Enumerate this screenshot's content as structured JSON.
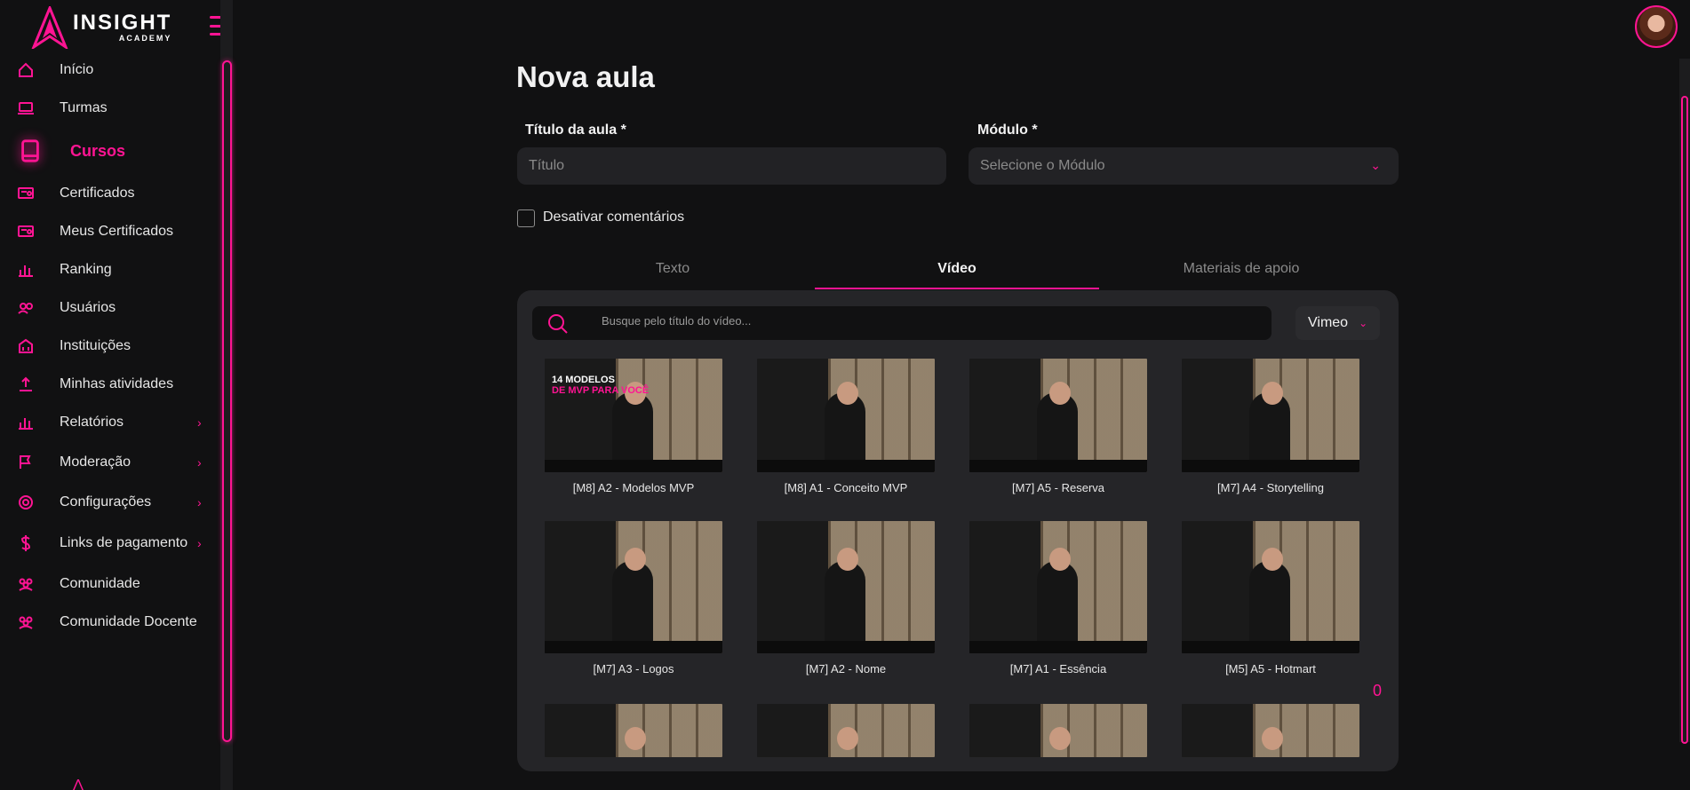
{
  "brand": {
    "name": "INSIGHT",
    "sub": "ACADEMY",
    "accent": "#ff1493"
  },
  "sidebar": {
    "items": [
      {
        "label": "Início",
        "icon": "home-icon"
      },
      {
        "label": "Turmas",
        "icon": "laptop-icon"
      },
      {
        "label": "Cursos",
        "icon": "book-icon",
        "active": true
      },
      {
        "label": "Certificados",
        "icon": "certificate-icon"
      },
      {
        "label": "Meus Certificados",
        "icon": "certificate-icon"
      },
      {
        "label": "Ranking",
        "icon": "bar-chart-icon"
      },
      {
        "label": "Usuários",
        "icon": "users-icon"
      },
      {
        "label": "Instituições",
        "icon": "building-icon"
      },
      {
        "label": "Minhas atividades",
        "icon": "upload-icon"
      },
      {
        "label": "Relatórios",
        "icon": "bar-chart-icon",
        "chevron": "›"
      },
      {
        "label": "Moderação",
        "icon": "flag-icon",
        "chevron": "›"
      },
      {
        "label": "Configurações",
        "icon": "gear-icon",
        "chevron": "›"
      },
      {
        "label": "Links de pagamento",
        "icon": "dollar-icon",
        "chevron": "›"
      },
      {
        "label": "Comunidade",
        "icon": "community-icon"
      },
      {
        "label": "Comunidade Docente",
        "icon": "community-icon"
      }
    ]
  },
  "form": {
    "title": "Nova aula",
    "lesson_title_label": "Título da aula *",
    "lesson_title_placeholder": "Título",
    "module_label": "Módulo *",
    "module_placeholder": "Selecione o Módulo",
    "disable_comments_label": "Desativar comentários"
  },
  "tabs": [
    {
      "label": "Texto"
    },
    {
      "label": "Vídeo",
      "active": true
    },
    {
      "label": "Materiais de apoio"
    }
  ],
  "video_panel": {
    "search_placeholder": "Busque pelo título do vídeo...",
    "provider": "Vimeo",
    "counter": "0",
    "videos": [
      {
        "title": "[M8] A2 - Modelos MVP",
        "overlay": "14 MODELOS",
        "overlay2": "DE MVP PARA VOCÊ"
      },
      {
        "title": "[M8] A1 - Conceito MVP",
        "overlay": "",
        "overlay2": ""
      },
      {
        "title": "[M7] A5 - Reserva",
        "overlay": "",
        "overlay2": ""
      },
      {
        "title": "[M7] A4 - Storytelling",
        "overlay": "",
        "overlay2": ""
      },
      {
        "title": "[M7] A3 - Logos",
        "overlay": "",
        "overlay2": ""
      },
      {
        "title": "[M7] A2 - Nome",
        "overlay": "",
        "overlay2": ""
      },
      {
        "title": "[M7] A1 - Essência",
        "overlay": "",
        "overlay2": ""
      },
      {
        "title": "[M5] A5 - Hotmart",
        "overlay": "",
        "overlay2": ""
      }
    ]
  }
}
